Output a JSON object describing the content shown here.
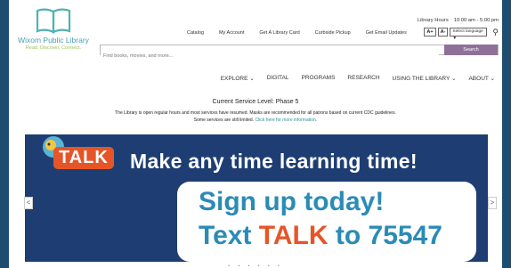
{
  "library": {
    "name": "Wixom Public Library",
    "tagline": "Read. Discover. Connect."
  },
  "top_links": [
    "Catalog",
    "My Account",
    "Get A Library Card",
    "Curbside Pickup",
    "Get Email Updates"
  ],
  "hours": {
    "label": "Library Hours",
    "value": "10:00 am - 5:00 pm"
  },
  "font_controls": {
    "increase": "A+",
    "decrease": "A-"
  },
  "language_select": {
    "selected": "Select language ▼"
  },
  "search": {
    "placeholder": "Find books, movies, and more...",
    "button": "Search"
  },
  "main_nav": [
    "EXPLORE ⌄",
    "DIGITAL",
    "PROGRAMS",
    "RESEARCH",
    "USING THE LIBRARY ⌄",
    "ABOUT ⌄"
  ],
  "notice": {
    "title": "Current Service Level: Phase 5",
    "line1": "The Library is open regular hours and most services have resumed. Masks are recommended for all patrons based on current CDC guidelines.",
    "line2": "Some services are still limited. ",
    "link": "Click here for more information."
  },
  "banner": {
    "badge": "TALK",
    "headline": "Make any time learning time!",
    "cta_line1": "Sign up today!",
    "cta_line2_pre": "Text ",
    "cta_line2_word": "TALK",
    "cta_line2_post": " to 75547"
  },
  "carousel": {
    "prev": "<",
    "next": ">",
    "dots": "• • • • • •"
  },
  "colors": {
    "frame": "#1e4d70",
    "banner_bg": "#1e3e73",
    "accent_orange": "#e65527",
    "search_button": "#8e7199",
    "teal": "#4a9fb0"
  }
}
